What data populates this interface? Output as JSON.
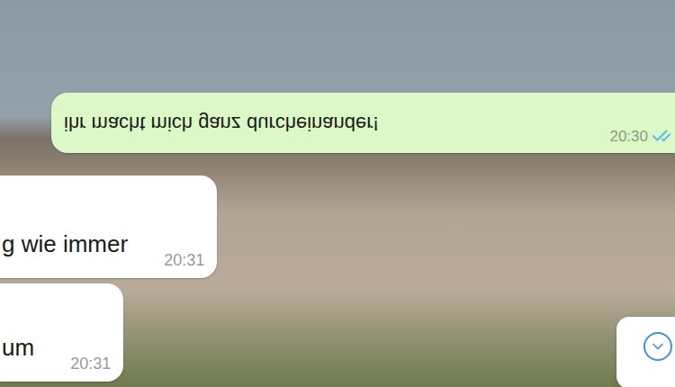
{
  "chat": {
    "messages": [
      {
        "text": "ihr macht mich ganz durcheinander!",
        "time": "20:30",
        "outgoing": true,
        "flipped": true,
        "read": true
      },
      {
        "text": "g wie immer",
        "time": "20:31",
        "outgoing": false,
        "flipped": false,
        "read": false
      },
      {
        "text": "um",
        "time": "20:31",
        "outgoing": false,
        "flipped": false,
        "read": false
      }
    ]
  }
}
